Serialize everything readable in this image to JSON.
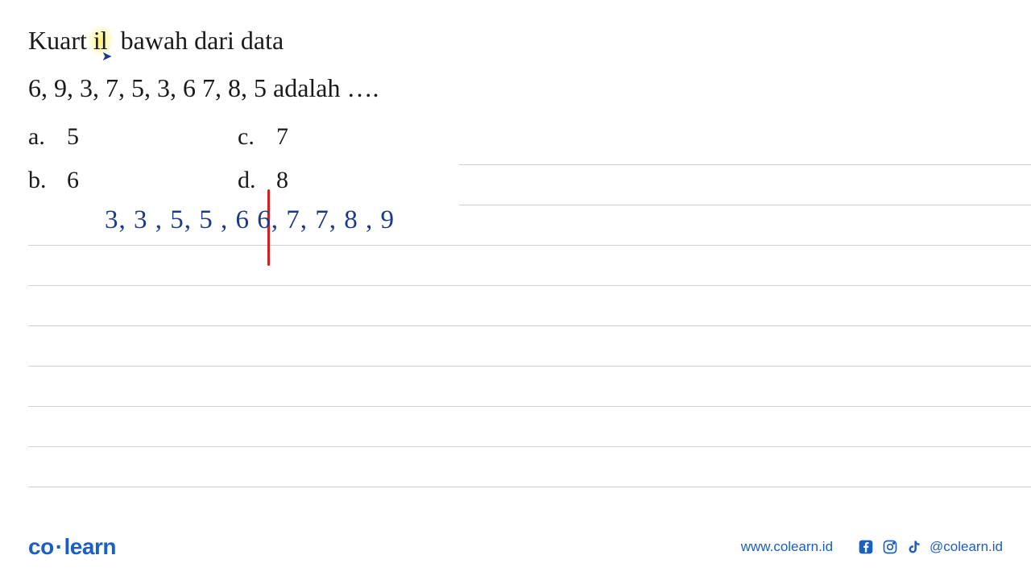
{
  "question": {
    "title_pre": "Kuart",
    "title_highlight": "il",
    "title_post": " bawah dari data",
    "data_line": "6, 9, 3, 7, 5, 3, 6 7, 8, 5 adalah ….",
    "options": {
      "a": {
        "label": "a.",
        "value": "5"
      },
      "b": {
        "label": "b.",
        "value": "6"
      },
      "c": {
        "label": "c.",
        "value": "7"
      },
      "d": {
        "label": "d.",
        "value": "8"
      }
    }
  },
  "handwritten": "3, 3 , 5, 5 , 6  6,  7, 7, 8 , 9",
  "footer": {
    "logo_co": "co",
    "logo_learn": "learn",
    "url": "www.colearn.id",
    "handle": "@colearn.id"
  }
}
